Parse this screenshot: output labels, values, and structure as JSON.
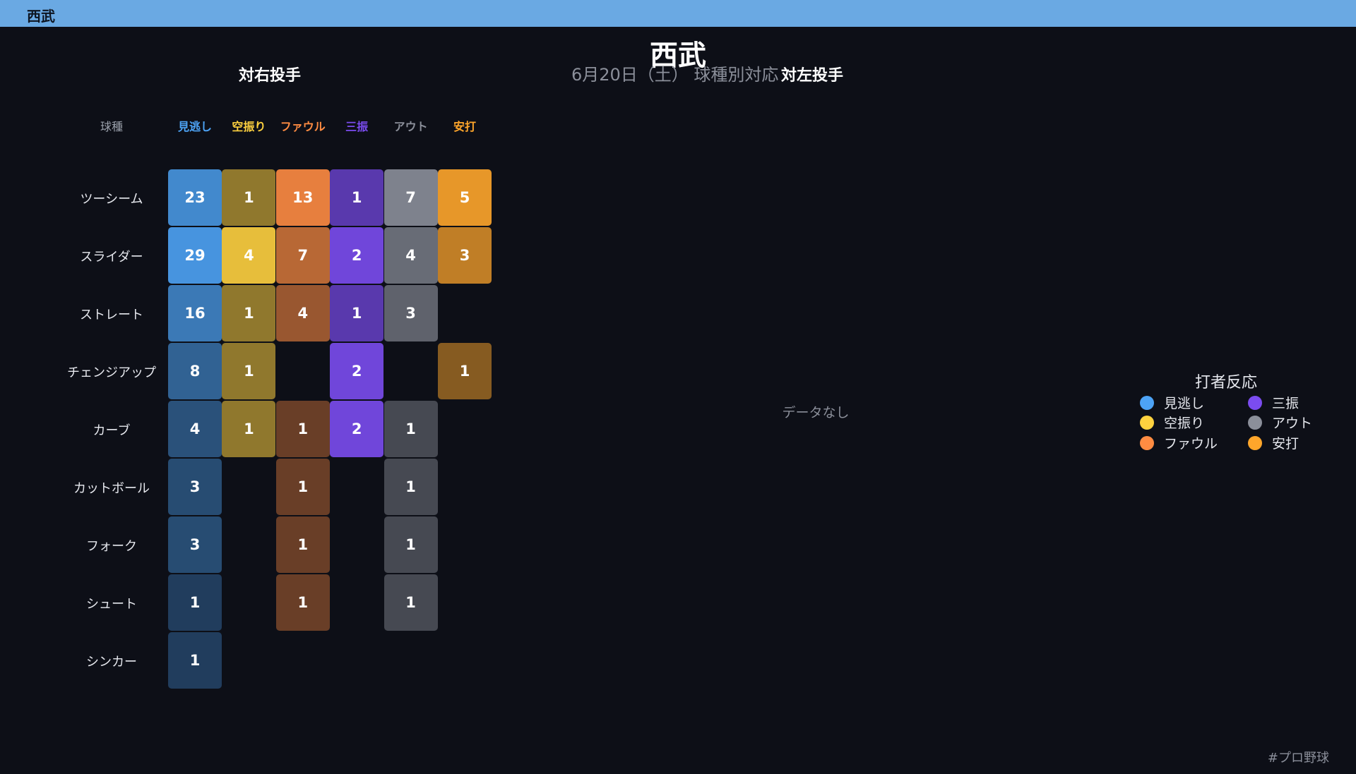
{
  "topbar": {
    "title": "西武"
  },
  "header": {
    "title": "西武",
    "subtitle": "6月20日（土） 球種別対応"
  },
  "chart_data": {
    "type": "heatmap",
    "title": "西武",
    "subtitle": "6月20日（土） 球種別対応",
    "corner_label": "球種",
    "columns": [
      "見逃し",
      "空振り",
      "ファウル",
      "三振",
      "アウト",
      "安打"
    ],
    "column_colors": [
      "#4da3f5",
      "#ffd23f",
      "#ff8c42",
      "#7b4cf0",
      "#8b8f9a",
      "#ffa62b"
    ],
    "panels": [
      {
        "name": "対右投手",
        "rows": [
          "ツーシーム",
          "スライダー",
          "ストレート",
          "チェンジアップ",
          "カーブ",
          "カットボール",
          "フォーク",
          "シュート",
          "シンカー"
        ],
        "values": [
          [
            23,
            1,
            13,
            1,
            7,
            5
          ],
          [
            29,
            4,
            7,
            2,
            4,
            3
          ],
          [
            16,
            1,
            4,
            1,
            3,
            null
          ],
          [
            8,
            1,
            null,
            2,
            null,
            1
          ],
          [
            4,
            1,
            1,
            2,
            1,
            null
          ],
          [
            3,
            null,
            1,
            null,
            1,
            null
          ],
          [
            3,
            null,
            1,
            null,
            1,
            null
          ],
          [
            1,
            null,
            1,
            null,
            1,
            null
          ],
          [
            1,
            null,
            null,
            null,
            null,
            null
          ]
        ]
      },
      {
        "name": "対左投手",
        "empty_text": "データなし"
      }
    ],
    "legend": {
      "title": "打者反応",
      "items": [
        "見逃し",
        "空振り",
        "ファウル",
        "三振",
        "アウト",
        "安打"
      ]
    }
  },
  "footer": {
    "hashtag": "#プロ野球"
  }
}
